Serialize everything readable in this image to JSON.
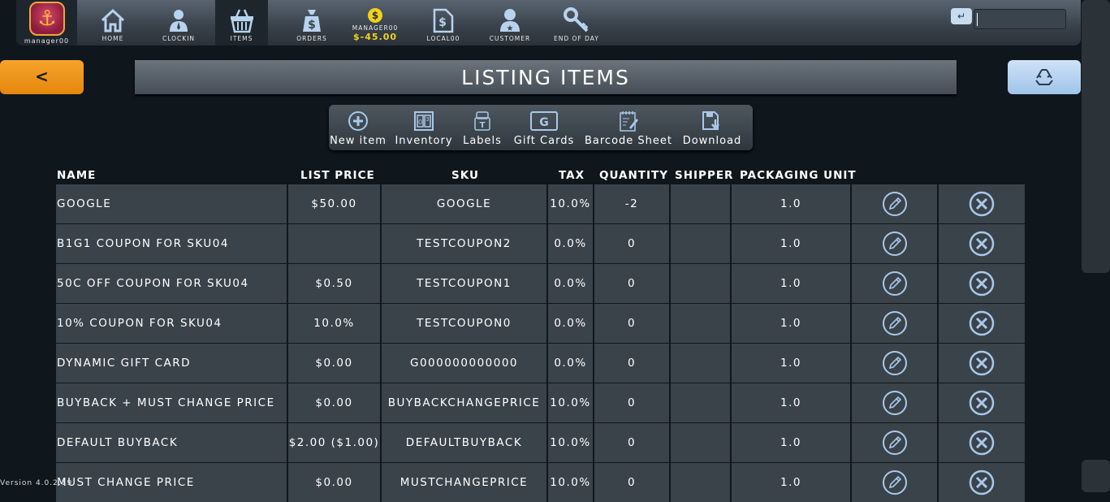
{
  "user": {
    "name": "manager00"
  },
  "nav": [
    {
      "label": "HOME",
      "icon": "home-icon"
    },
    {
      "label": "CLOCKIN",
      "icon": "person-icon"
    },
    {
      "label": "ITEMS",
      "icon": "basket-icon"
    },
    {
      "label": "ORDERS",
      "icon": "money-bag-icon"
    },
    {
      "label": "LOCAL00",
      "icon": "register-icon"
    },
    {
      "label": "CUSTOMER",
      "icon": "customer-icon"
    },
    {
      "label": "END OF DAY",
      "icon": "key-icon"
    }
  ],
  "balance": {
    "name": "MANAGER00",
    "amount": "$-45.00",
    "coin": "$"
  },
  "enter_symbol": "↵",
  "back_label": "<",
  "page_title": "LISTING ITEMS",
  "toolbar": [
    {
      "label": "New item",
      "icon": "plus-circle-icon"
    },
    {
      "label": "Inventory",
      "icon": "inventory-icon"
    },
    {
      "label": "Labels",
      "icon": "label-tag-icon"
    },
    {
      "label": "Gift Cards",
      "icon": "gift-card-icon"
    },
    {
      "label": "Barcode Sheet",
      "icon": "barcode-sheet-icon"
    },
    {
      "label": "Download",
      "icon": "download-icon"
    }
  ],
  "gift_card_letter": "G",
  "columns": [
    "NAME",
    "LIST PRICE",
    "SKU",
    "TAX",
    "QUANTITY",
    "SHIPPER",
    "PACKAGING UNIT"
  ],
  "rows": [
    {
      "name": "GOOGLE",
      "price": "$50.00",
      "sku": "GOOGLE",
      "tax": "10.0%",
      "qty": "-2",
      "shipper": "",
      "unit": "1.0"
    },
    {
      "name": "B1G1 COUPON FOR SKU04",
      "price": "",
      "sku": "TESTCOUPON2",
      "tax": "0.0%",
      "qty": "0",
      "shipper": "",
      "unit": "1.0"
    },
    {
      "name": "50C OFF COUPON FOR SKU04",
      "price": "$0.50",
      "sku": "TESTCOUPON1",
      "tax": "0.0%",
      "qty": "0",
      "shipper": "",
      "unit": "1.0"
    },
    {
      "name": "10% COUPON FOR SKU04",
      "price": "10.0%",
      "sku": "TESTCOUPON0",
      "tax": "0.0%",
      "qty": "0",
      "shipper": "",
      "unit": "1.0"
    },
    {
      "name": "DYNAMIC GIFT CARD",
      "price": "$0.00",
      "sku": "G000000000000",
      "tax": "0.0%",
      "qty": "0",
      "shipper": "",
      "unit": "1.0"
    },
    {
      "name": "BUYBACK + MUST CHANGE PRICE",
      "price": "$0.00",
      "sku": "BUYBACKCHANGEPRICE",
      "tax": "10.0%",
      "qty": "0",
      "shipper": "",
      "unit": "1.0"
    },
    {
      "name": "DEFAULT BUYBACK",
      "price": "$2.00 ($1.00)",
      "sku": "DEFAULTBUYBACK",
      "tax": "10.0%",
      "qty": "0",
      "shipper": "",
      "unit": "1.0"
    },
    {
      "name": "MUST CHANGE PRICE",
      "price": "$0.00",
      "sku": "MUSTCHANGEPRICE",
      "tax": "10.0%",
      "qty": "0",
      "shipper": "",
      "unit": "1.0"
    }
  ],
  "version": "Version 4.0.2.19",
  "colors": {
    "accent_orange": "#f7a32a",
    "accent_blue": "#bcd8f3",
    "icon_blue": "#a9c8ea",
    "cell_bg": "#3a434a",
    "page_bg": "#0f171d",
    "balance_yellow": "#f3d21a"
  }
}
